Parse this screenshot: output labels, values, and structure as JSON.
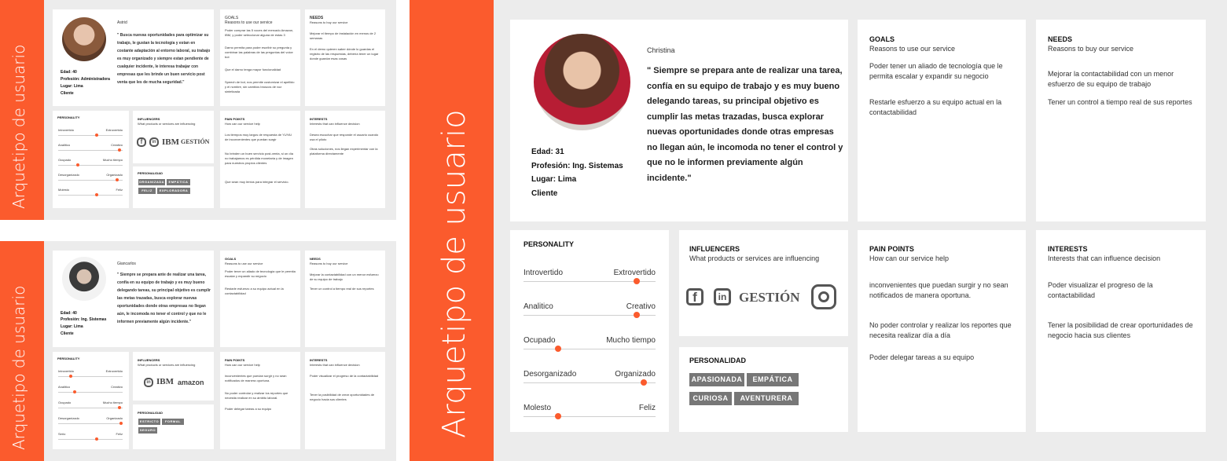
{
  "band_title": "Arquetipo de usuario",
  "accent_color": "#fb5b2d",
  "panel_a": {
    "name": "Astrid",
    "quote": "\" Busca nuevas oportunidades para optimizar su trabajo, le gustan la tecnología y estan en costante adaptación al entorno laboral, su trabajo es muy organizado y siempre estan pendiente de cualquier incidente, le interesa trabajar con empresas que les brinde un buen servicio post venta que les de mucha seguridad.\"",
    "facts": [
      "Edad: 40",
      "Profesión: Administradora",
      "Lugar: Lima",
      "Cliente"
    ],
    "goals_title": "GOALS",
    "goals_sub": "Reasons to use our service",
    "goals_items": [
      "Poder comprar las 5 voces del mercado Amazon, IBM, y poder seleccionar alguna de estas 3",
      "Darno permita para poder escribir su pregunta y combinar las palabras de las preguntas del voice bot",
      "Que el darno tenga mayor funcionalidad",
      "Speech de bot, nos permite customizar el apellido y el nombre, sin cambios bruscos de voz sintetizada"
    ],
    "needs_title": "NEEDS",
    "needs_sub": "Reasons to buy our service",
    "needs_items": [
      "Mejorar el tiempo de instalación en menos de 2 semanas",
      "En el demo quieren saber dónde lo guardas el registro de las respuestas, debería tener un lugar donde guardar esas cosas"
    ],
    "personality_title": "PERSONALITY",
    "personality": [
      {
        "left": "Introvertido",
        "right": "Extrovertido",
        "value": 0.6
      },
      {
        "left": "Analitico",
        "right": "Creativo",
        "value": 0.95
      },
      {
        "left": "Ocupado",
        "right": "Mucho tiempo",
        "value": 0.3
      },
      {
        "left": "Desorganizado",
        "right": "Organizado",
        "value": 0.92
      },
      {
        "left": "Molesto",
        "right": "Feliz",
        "value": 0.6
      }
    ],
    "influencers_title": "INFLUENCERS",
    "influencers_sub": "What products or services are influencing",
    "logos": [
      "f",
      "in",
      "IBM",
      "GESTIÓN"
    ],
    "pain_title": "PAIN POINTS",
    "pain_sub": "How can our service help",
    "pain_items": [
      "Los tiempos muy largos de respuesta de YUYAI de inconvenientes que puedan surgir",
      "No brinden un buen servicio post-venta, si un día no trabajamos es pérdida monetaria y de imagen para nuestros propios clientes",
      "Que sean muy lentos para integrar el servicio."
    ],
    "interests_title": "INTERESTS",
    "interests_sub": "Interests that can influence decision",
    "interests_items": [
      "Desea escuchar que responde el usuario cuando usa el piloto",
      "Otras soluciones, nos llegan experimentar con la plataforma directamente"
    ],
    "personalidad_title": "PERSONALIDAD",
    "tags": [
      "ORGANIZADA",
      "EMPÁTICA",
      "FELIZ",
      "EXPLORADORA"
    ]
  },
  "panel_b": {
    "name": "Giancarlos",
    "quote": "\" Siempre se prepara ante de realizar una tarea, confía en su equipo de trabajo y es muy bueno delegando tareas, su principal objetivo es cumplir las metas trazadas, busca explorar nuevas oportunidades donde otras empresas no llegan aún, le incomoda no tener el control y que no le informen previamente algún incidente.\"",
    "facts": [
      "Edad: 40",
      "Profesión: Ing. Sistemas",
      "Lugar: Lima",
      "Cliente"
    ],
    "goals_title": "GOALS",
    "goals_sub": "Reasons to use our service",
    "goals_items": [
      "Poder tener un aliado de tecnología que le permita escalar y expandir su negocio",
      "Restarle esfuerzo a su equipo actual en la contactabilidad"
    ],
    "needs_title": "NEEDS",
    "needs_sub": "Reasons to buy our service",
    "needs_items": [
      "Mejorar la contactabilidad con un menor esfuerzo de su equipo de trabajo",
      "Tener un control a tiempo real de sus reportes"
    ],
    "personality_title": "PERSONALITY",
    "personality": [
      {
        "left": "Introvertido",
        "right": "Extrovertido",
        "value": 0.2
      },
      {
        "left": "Analitico",
        "right": "Creativo",
        "value": 0.25
      },
      {
        "left": "Ocupado",
        "right": "Mucho tiempo",
        "value": 0.95
      },
      {
        "left": "Desorganizado",
        "right": "Organizado",
        "value": 0.97
      },
      {
        "left": "Serio",
        "right": "Feliz",
        "value": 0.6
      }
    ],
    "influencers_title": "INFLUENCERS",
    "influencers_sub": "What products or services are influencing",
    "logos": [
      "in",
      "IBM",
      "amazon"
    ],
    "pain_title": "PAIN POINTS",
    "pain_sub": "How can our service help",
    "pain_items": [
      "inconvenientes que puedan surgir y no sean notificados de manera oportuna.",
      "No poder controlar y realizar los reportes que necesita realizar en su ámbito laboral.",
      "Poder delegar tareas a su equipo"
    ],
    "interests_title": "INTERESTS",
    "interests_sub": "Interests that can influence decision",
    "interests_items": [
      "Poder visualizar el progreso de la contactabilidad",
      "Tener la posibilidad de crear oportunidades de negocio hacia sus clientes"
    ],
    "personalidad_title": "PERSONALIDAD",
    "tags": [
      "ESTRICTO",
      "FORMAL",
      "SEGURO"
    ]
  },
  "panel_c": {
    "name": "Christina",
    "quote": "\" Siempre se prepara ante de realizar una tarea, confía en su equipo de trabajo y es muy bueno delegando tareas, su principal objetivo es cumplir las metas trazadas, busca explorar nuevas oportunidades donde otras empresas no llegan aún, le incomoda no tener el control y que no le informen previamente algún incidente.\"",
    "facts": [
      "Edad: 31",
      "Profesión: Ing. Sistemas",
      "Lugar: Lima",
      "Cliente"
    ],
    "goals_title": "GOALS",
    "goals_sub": "Reasons to use our service",
    "goals_items": [
      "Poder tener un aliado de tecnología que le permita escalar y expandir su negocio",
      "Restarle esfuerzo a su equipo actual en la contactabilidad"
    ],
    "needs_title": "NEEDS",
    "needs_sub": "Reasons to buy our service",
    "needs_items": [
      "Mejorar la contactabilidad con un menor esfuerzo de su equipo de trabajo",
      "Tener un control a tiempo real de sus reportes"
    ],
    "personality_title": "PERSONALITY",
    "personality": [
      {
        "left": "Introvertido",
        "right": "Extrovertido",
        "value": 0.86
      },
      {
        "left": "Analitico",
        "right": "Creativo",
        "value": 0.86
      },
      {
        "left": "Ocupado",
        "right": "Mucho tiempo",
        "value": 0.26
      },
      {
        "left": "Desorganizado",
        "right": "Organizado",
        "value": 0.91
      },
      {
        "left": "Molesto",
        "right": "Feliz",
        "value": 0.26
      }
    ],
    "influencers_title": "INFLUENCERS",
    "influencers_sub": "What products or services are influencing",
    "logos": [
      "f",
      "in",
      "GESTIÓN",
      "instagram"
    ],
    "pain_title": "PAIN POINTS",
    "pain_sub": "How can our service help",
    "pain_items": [
      "inconvenientes que puedan surgir y no sean notificados de manera oportuna.",
      "No poder controlar y realizar los reportes que necesita realizar día a día",
      "Poder delegar tareas a su equipo"
    ],
    "interests_title": "INTERESTS",
    "interests_sub": "Interests that can influence decision",
    "interests_items": [
      "Poder visualizar el progreso de la contactabilidad",
      "Tener la posibilidad de crear oportunidades de negocio hacia sus clientes"
    ],
    "personalidad_title": "PERSONALIDAD",
    "tags": [
      "APASIONADA",
      "EMPÁTICA",
      "CURIOSA",
      "AVENTURERA"
    ]
  }
}
